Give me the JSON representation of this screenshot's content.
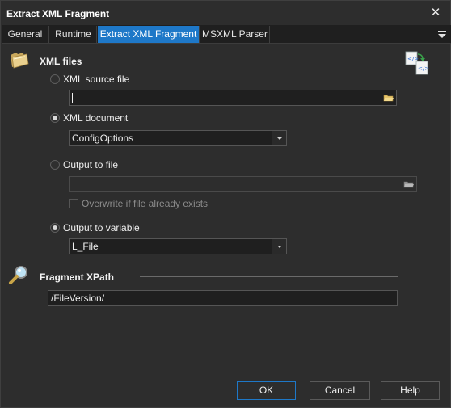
{
  "window": {
    "title": "Extract XML Fragment"
  },
  "tabs": [
    {
      "label": "General"
    },
    {
      "label": "Runtime"
    },
    {
      "label": "Extract XML Fragment"
    },
    {
      "label": "MSXML Parser"
    }
  ],
  "xml_files": {
    "heading": "XML files",
    "source_file": {
      "label": "XML source file",
      "selected": false,
      "value": ""
    },
    "document": {
      "label": "XML document",
      "selected": true,
      "value": "ConfigOptions"
    },
    "output_to_file": {
      "label": "Output to file",
      "selected": false,
      "value": "",
      "overwrite_label": "Overwrite if file already exists"
    },
    "output_to_variable": {
      "label": "Output to variable",
      "selected": true,
      "value": "L_File"
    }
  },
  "fragment": {
    "heading": "Fragment XPath",
    "value": "/FileVersion/"
  },
  "buttons": {
    "ok": "OK",
    "cancel": "Cancel",
    "help": "Help"
  },
  "colors": {
    "accent": "#1e78c8",
    "background": "#2d2d2d",
    "field": "#1f1f1f"
  }
}
